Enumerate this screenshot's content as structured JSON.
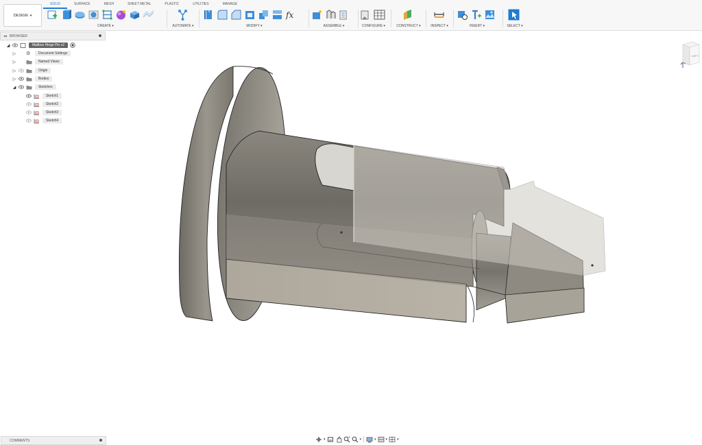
{
  "toolbar": {
    "workspace": "DESIGN",
    "tabs": [
      {
        "label": "SOLID",
        "active": true
      },
      {
        "label": "SURFACE",
        "active": false
      },
      {
        "label": "MESH",
        "active": false
      },
      {
        "label": "SHEET METAL",
        "active": false
      },
      {
        "label": "PLASTIC",
        "active": false
      },
      {
        "label": "UTILITIES",
        "active": false
      },
      {
        "label": "MANAGE",
        "active": false
      }
    ],
    "groups": {
      "create": "CREATE ▾",
      "automate": "AUTOMATE ▾",
      "modify": "MODIFY ▾",
      "assemble": "ASSEMBLE ▾",
      "configure": "CONFIGURE ▾",
      "construct": "CONSTRUCT ▾",
      "inspect": "INSPECT ▾",
      "insert": "INSERT ▾",
      "select": "SELECT ▾"
    },
    "accent_color": "#1e7cd2"
  },
  "browser": {
    "title": "BROWSER",
    "root": "Mailbox Hinge Pin v2",
    "items": [
      {
        "label": "Document Settings",
        "icon": "gear-icon"
      },
      {
        "label": "Named Views",
        "icon": "folder-icon"
      },
      {
        "label": "Origin",
        "icon": "folder-icon"
      },
      {
        "label": "Bodies",
        "icon": "folder-icon"
      },
      {
        "label": "Sketches",
        "icon": "folder-icon"
      }
    ],
    "sketches": [
      "Sketch1",
      "Sketch2",
      "Sketch3",
      "Sketch4"
    ]
  },
  "comments": {
    "title": "COMMENTS"
  },
  "viewcube": {
    "face": "LEFT"
  }
}
